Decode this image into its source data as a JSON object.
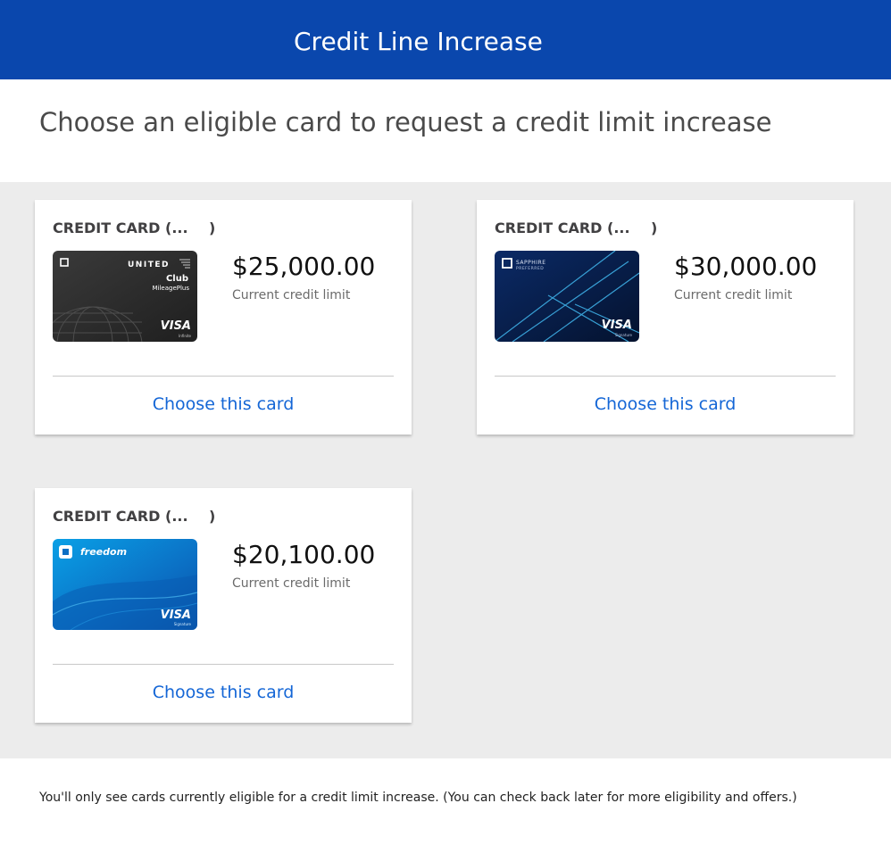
{
  "header": {
    "title": "Credit Line Increase"
  },
  "page": {
    "heading": "Choose an eligible card to request a credit limit increase"
  },
  "cards": [
    {
      "title": "CREDIT CARD (...",
      "title_close": ")",
      "amount": "$25,000.00",
      "amount_label": "Current credit limit",
      "action": "Choose this card",
      "art": {
        "brand": "UNITED",
        "line1": "Club",
        "line2": "MileagePlus",
        "network": "VISA",
        "tier": "Infinite"
      }
    },
    {
      "title": "CREDIT CARD (...",
      "title_close": ")",
      "amount": "$30,000.00",
      "amount_label": "Current credit limit",
      "action": "Choose this card",
      "art": {
        "brand": "SAPPHIRE",
        "line1": "PREFERRED",
        "network": "VISA",
        "tier": "Signature"
      }
    },
    {
      "title": "CREDIT CARD (...",
      "title_close": ")",
      "amount": "$20,100.00",
      "amount_label": "Current credit limit",
      "action": "Choose this card",
      "art": {
        "brand": "freedom",
        "network": "VISA",
        "tier": "Signature"
      }
    }
  ],
  "footer": {
    "note": "You'll only see cards currently eligible for a credit limit increase. (You can check back later for more eligibility and offers.)"
  },
  "colors": {
    "header_bg": "#0a47ad",
    "link": "#1466d6",
    "area_bg": "#ececec"
  }
}
